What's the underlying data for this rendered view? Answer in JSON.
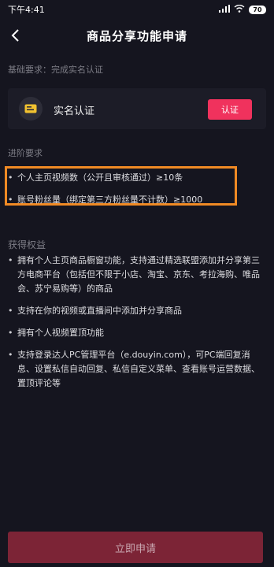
{
  "status_bar": {
    "time": "下午4:41",
    "signal": "|||",
    "wifi": "WiFi",
    "battery": "70"
  },
  "nav": {
    "back_icon": "back-chevron-icon",
    "title": "商品分享功能申请"
  },
  "basic": {
    "label": "基础要求：完成实名认证",
    "card_label": "实名认证",
    "button": "认证",
    "icon": "id-card-icon"
  },
  "advanced": {
    "label": "进阶要求",
    "items": [
      "个人主页视频数（公开且审核通过）≥10条",
      "账号粉丝量（绑定第三方粉丝量不计数）≥1000"
    ]
  },
  "benefits": {
    "label": "获得权益",
    "items": [
      "拥有个人主页商品橱窗功能，支持通过精选联盟添加并分享第三方电商平台（包括但不限于小店、淘宝、京东、考拉海购、唯品会、苏宁易购等）的商品",
      "支持在你的视频或直播间中添加并分享商品",
      "拥有个人视频置顶功能",
      "支持登录达人PC管理平台（e.douyin.com），可PC端回复消息、设置私信自动回复、私信自定义菜单、查看账号运营数据、置顶评论等"
    ]
  },
  "footer": {
    "apply_button": "立即申请"
  },
  "colors": {
    "accent": "#f0325d",
    "highlight": "#f08a24",
    "background": "#15151f"
  }
}
